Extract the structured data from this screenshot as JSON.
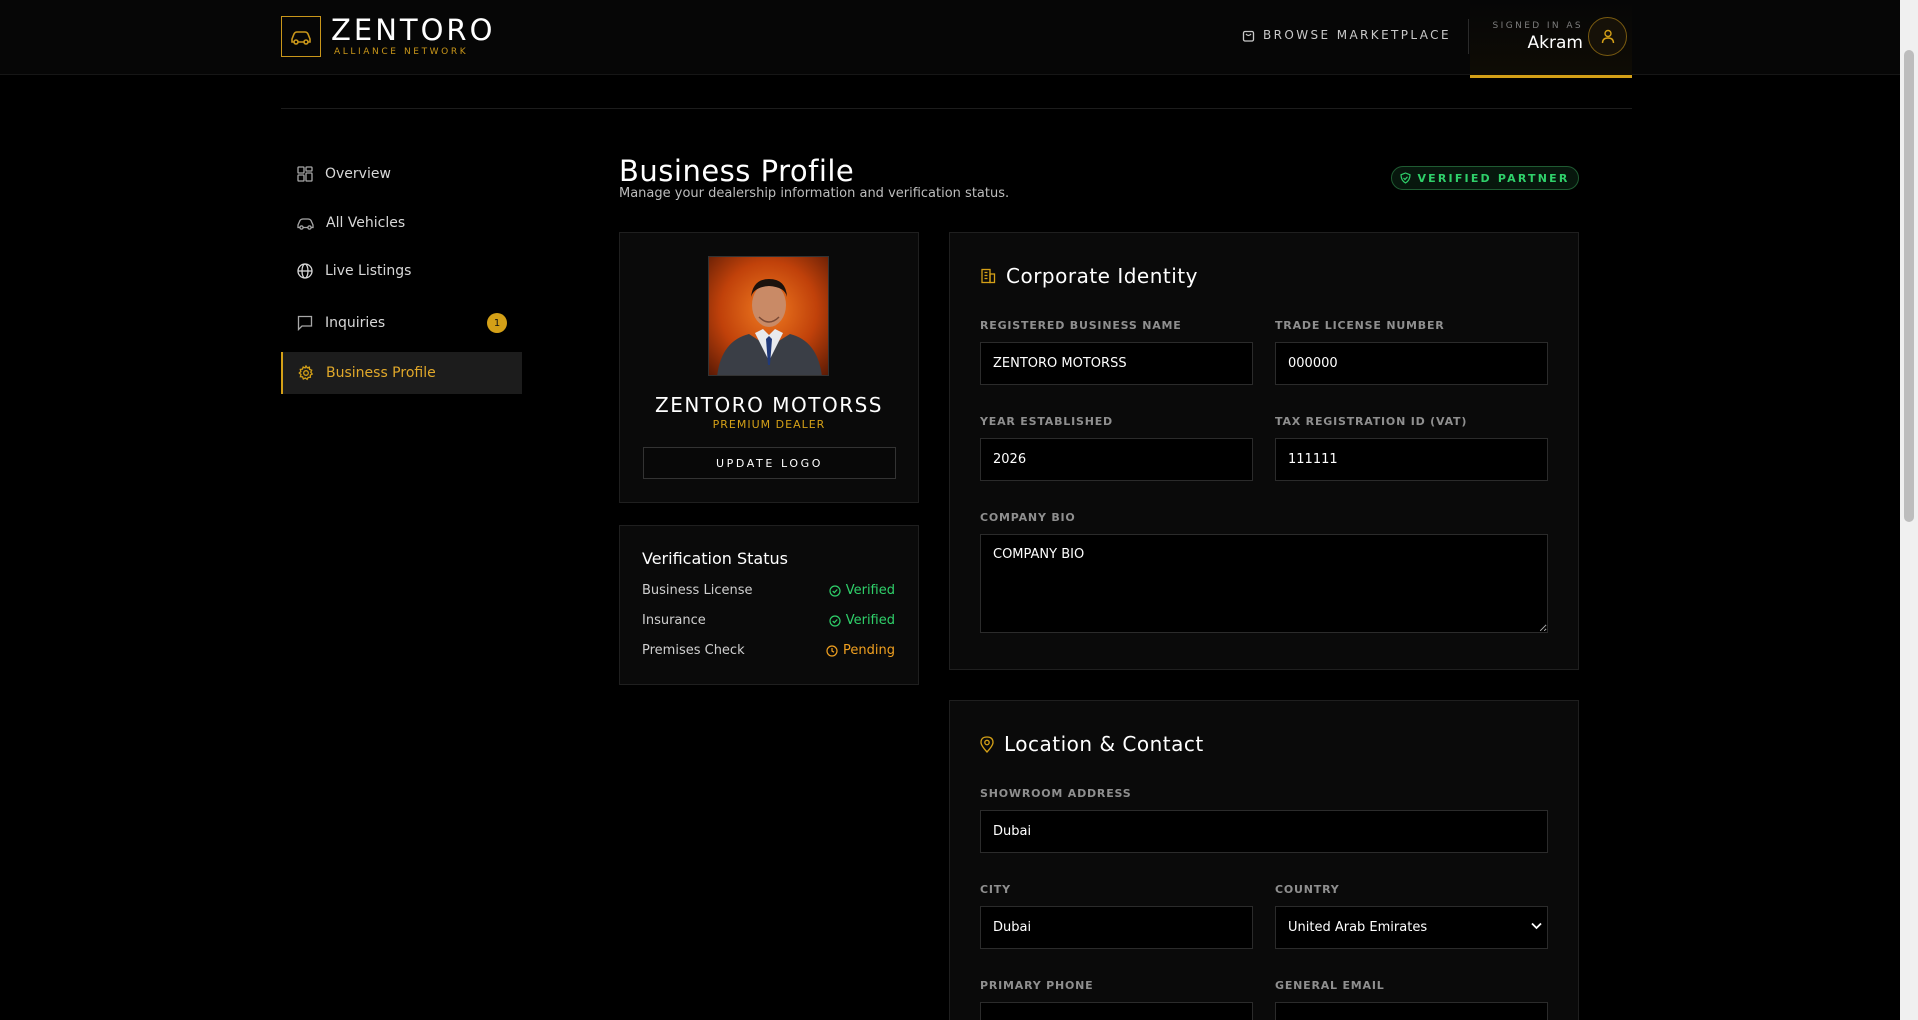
{
  "header": {
    "brand": "ZENTORO",
    "brand_sub": "ALLIANCE NETWORK",
    "browse_label": "BROWSE MARKETPLACE",
    "signed_in_label": "SIGNED IN AS",
    "user_name": "Akram"
  },
  "sidebar": {
    "items": [
      {
        "label": "Overview",
        "icon": "grid-icon"
      },
      {
        "label": "All Vehicles",
        "icon": "car-icon"
      },
      {
        "label": "Live Listings",
        "icon": "globe-icon"
      },
      {
        "label": "Inquiries",
        "icon": "message-icon",
        "badge": "1"
      },
      {
        "label": "Business Profile",
        "icon": "gear-icon",
        "active": true
      }
    ]
  },
  "page": {
    "title": "Business Profile",
    "subtitle": "Manage your dealership information and verification status.",
    "status_pill": "VERIFIED PARTNER"
  },
  "profile_card": {
    "company_name": "ZENTORO MOTORSS",
    "tier": "PREMIUM DEALER",
    "update_logo_label": "UPDATE LOGO"
  },
  "verification": {
    "title": "Verification Status",
    "rows": [
      {
        "label": "Business License",
        "status": "Verified"
      },
      {
        "label": "Insurance",
        "status": "Verified"
      },
      {
        "label": "Premises Check",
        "status": "Pending"
      }
    ]
  },
  "corporate": {
    "title": "Corporate Identity",
    "business_name_label": "REGISTERED BUSINESS NAME",
    "business_name_value": "ZENTORO MOTORSS",
    "trade_license_label": "TRADE LICENSE NUMBER",
    "trade_license_value": "000000",
    "year_label": "YEAR ESTABLISHED",
    "year_value": "2026",
    "tax_label": "TAX REGISTRATION ID (VAT)",
    "tax_value": "111111",
    "bio_label": "COMPANY BIO",
    "bio_value": "COMPANY BIO"
  },
  "location": {
    "title": "Location & Contact",
    "address_label": "SHOWROOM ADDRESS",
    "address_value": "Dubai",
    "city_label": "CITY",
    "city_value": "Dubai",
    "country_label": "COUNTRY",
    "country_value": "United Arab Emirates",
    "phone_label": "PRIMARY PHONE",
    "email_label": "GENERAL EMAIL"
  },
  "colors": {
    "accent": "#d4a017",
    "success": "#2fd06a",
    "pending": "#f0a020",
    "background": "#000000"
  }
}
